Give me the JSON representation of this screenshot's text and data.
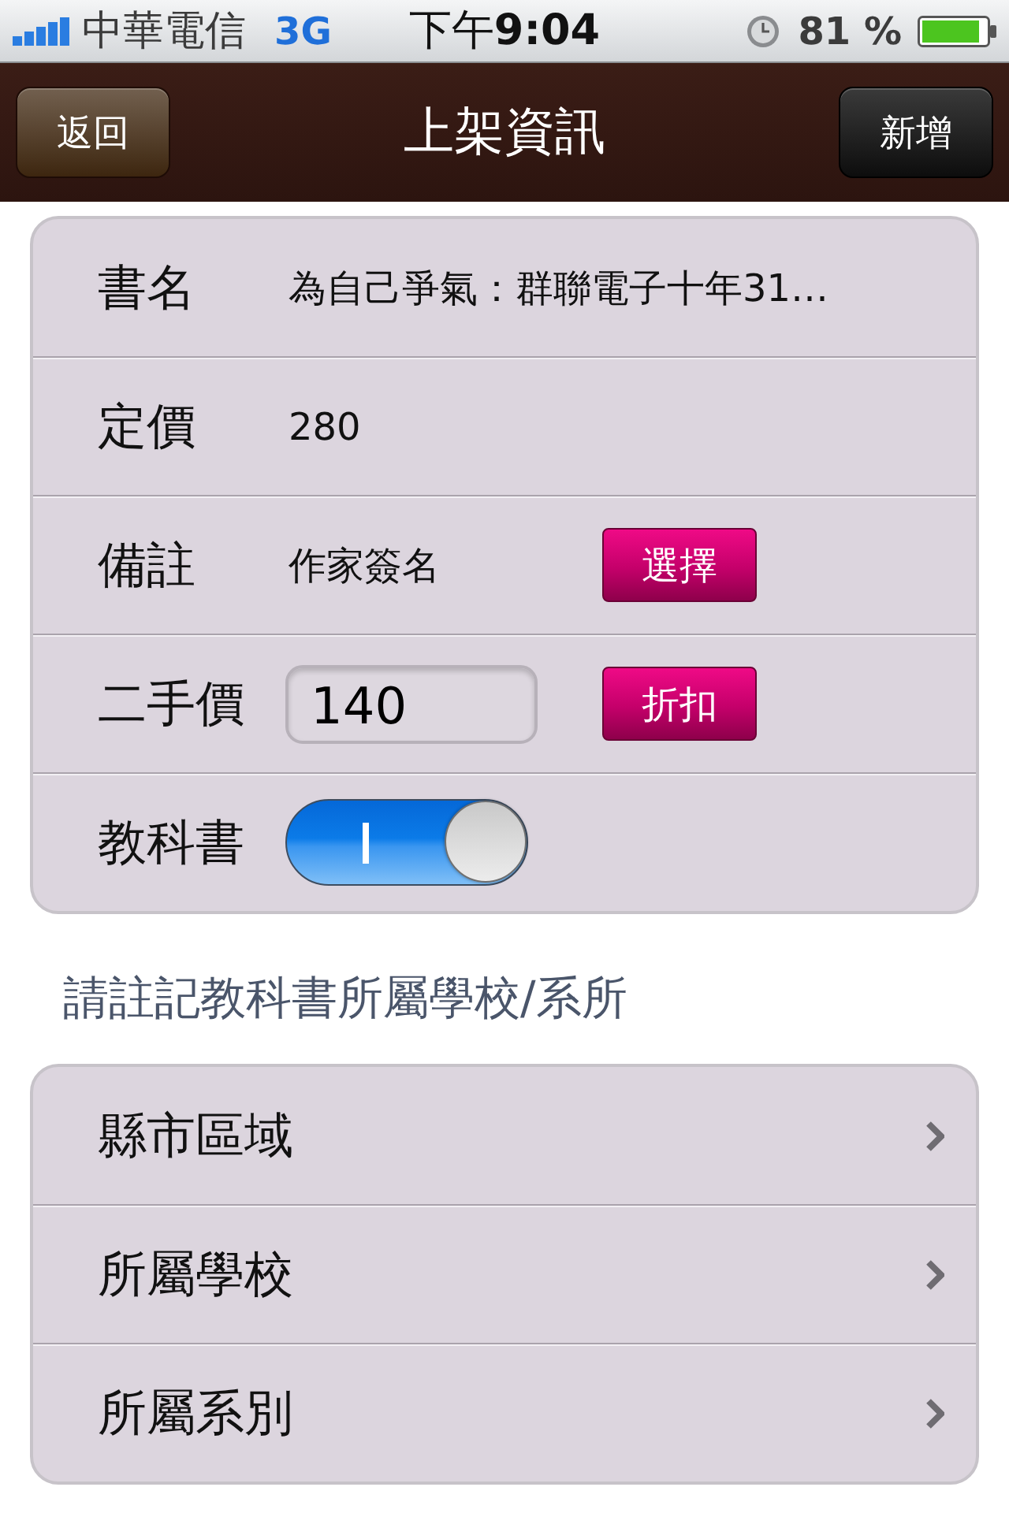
{
  "status_bar": {
    "carrier": "中華電信",
    "network": "3G",
    "time": "下午**9:04**",
    "battery": "81 %"
  },
  "nav_bar": {
    "back_button": "返回",
    "title": "上架資訊",
    "right_button": "新增"
  },
  "form_rows": [
    {
      "kind": "text",
      "label": "書名",
      "value": "為自己爭氣：群聯電子十年31…"
    },
    {
      "kind": "text",
      "label": "定價",
      "value": "280"
    },
    {
      "kind": "text",
      "label": "備註",
      "value": "作家簽名",
      "button": "選擇"
    },
    {
      "kind": "input",
      "label": "二手價",
      "value": "140",
      "button": "折扣"
    },
    {
      "kind": "toggle",
      "label": "教科書",
      "on": true
    }
  ],
  "section_header": "請註記教科書所屬學校/系所",
  "school_rows": [
    {
      "label": "縣市區域"
    },
    {
      "label": "所屬學校"
    },
    {
      "label": "所屬系別"
    }
  ]
}
